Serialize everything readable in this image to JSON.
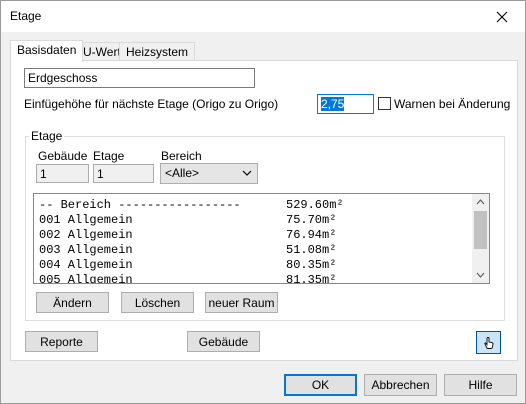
{
  "window": {
    "title": "Etage"
  },
  "tabs": [
    {
      "label": "Basisdaten",
      "active": true
    },
    {
      "label": "U-Wert",
      "active": false
    },
    {
      "label": "Heizsystem",
      "active": false
    }
  ],
  "basis": {
    "name_value": "Erdgeschoss",
    "height_label": "Einfügehöhe für nächste Etage (Origo zu Origo)",
    "height_value": "2,75",
    "warn_label": "Warnen bei Änderung"
  },
  "etage_group": {
    "legend": "Etage",
    "gebaeude_label": "Gebäude",
    "gebaeude_value": "1",
    "etage_label": "Etage",
    "etage_value": "1",
    "bereich_label": "Bereich",
    "bereich_value": "<Alle>"
  },
  "list": {
    "rows": [
      {
        "name": "-- Bereich -----------------",
        "area": "529.60m²"
      },
      {
        "name": "001 Allgemein",
        "area": "75.70m²"
      },
      {
        "name": "002 Allgemein",
        "area": "76.94m²"
      },
      {
        "name": "003 Allgemein",
        "area": "51.08m²"
      },
      {
        "name": "004 Allgemein",
        "area": "80.35m²"
      },
      {
        "name": "005 Allgemein",
        "area": "81.35m²"
      }
    ]
  },
  "buttons": {
    "aendern": "Ändern",
    "loeschen": "Löschen",
    "neuer_raum": "neuer Raum",
    "reporte": "Reporte",
    "gebaeude": "Gebäude",
    "ok": "OK",
    "abbrechen": "Abbrechen",
    "hilfe": "Hilfe"
  },
  "colors": {
    "selection": "#0078d7",
    "accent": "#0078d7"
  },
  "icons": {
    "close": "close-icon",
    "tool": "hand-pointer-icon"
  }
}
